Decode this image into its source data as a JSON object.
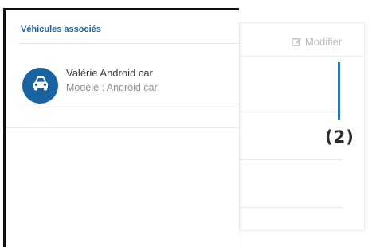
{
  "panel": {
    "title": "Véhicules associés",
    "vehicles": [
      {
        "name": "Valérie Android car",
        "model": "Modèle : Android car",
        "icon": "car-icon"
      }
    ]
  },
  "background": {
    "edit_label": "Modifier",
    "edit_icon": "edit-icon"
  },
  "annotation": {
    "label": "(2)",
    "color": "#2a6fa8"
  },
  "colors": {
    "accent": "#1a63a3",
    "title": "#1f5f98"
  }
}
